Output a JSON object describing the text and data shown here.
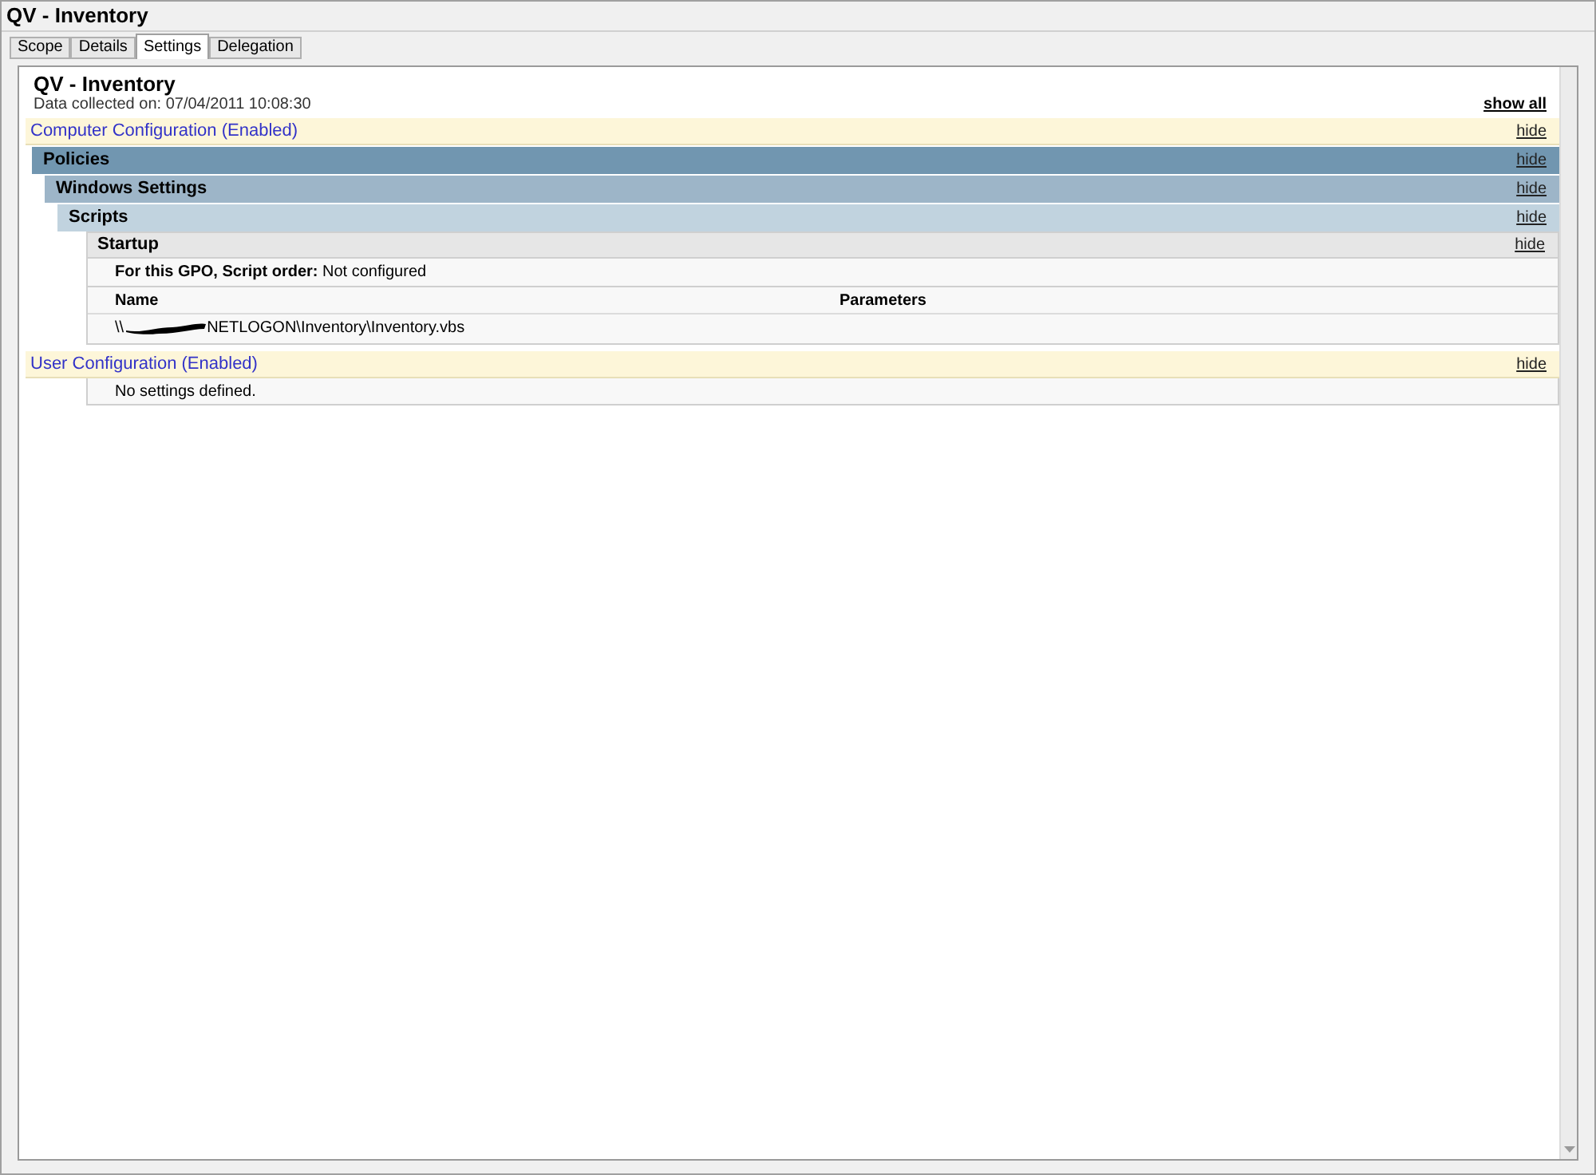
{
  "window": {
    "title": "QV - Inventory"
  },
  "tabs": [
    {
      "label": "Scope",
      "selected": false
    },
    {
      "label": "Details",
      "selected": false
    },
    {
      "label": "Settings",
      "selected": true
    },
    {
      "label": "Delegation",
      "selected": false
    }
  ],
  "report": {
    "title": "QV - Inventory",
    "collected": "Data collected on: 07/04/2011 10:08:30",
    "show_all": "show all",
    "sections": [
      {
        "kind": "config",
        "title": "Computer Configuration (Enabled)",
        "hide": "hide",
        "children": [
          {
            "kind": "category",
            "title": "Policies",
            "hide": "hide",
            "children": [
              {
                "kind": "category",
                "title": "Windows Settings",
                "hide": "hide",
                "children": [
                  {
                    "kind": "category",
                    "title": "Scripts",
                    "hide": "hide",
                    "children": [
                      {
                        "kind": "extension",
                        "title": "Startup",
                        "hide": "hide",
                        "children": [
                          {
                            "kind": "setting",
                            "text": "**For this GPO, Script order:** Not configured"
                          },
                          {
                            "kind": "table",
                            "columns": [
                              "Name",
                              "Parameters"
                            ],
                            "rows": [
                              {
                                "before": "\\\\",
                                "after": "NETLOGON\\Inventory\\Inventory.vbs",
                                "redacted": true
                              }
                            ]
                          }
                        ]
                      }
                    ]
                  }
                ]
              }
            ]
          }
        ]
      },
      {
        "kind": "config",
        "title": "User Configuration (Enabled)",
        "hide": "hide",
        "children": [
          {
            "kind": "note",
            "text": "No settings defined."
          }
        ]
      }
    ]
  }
}
